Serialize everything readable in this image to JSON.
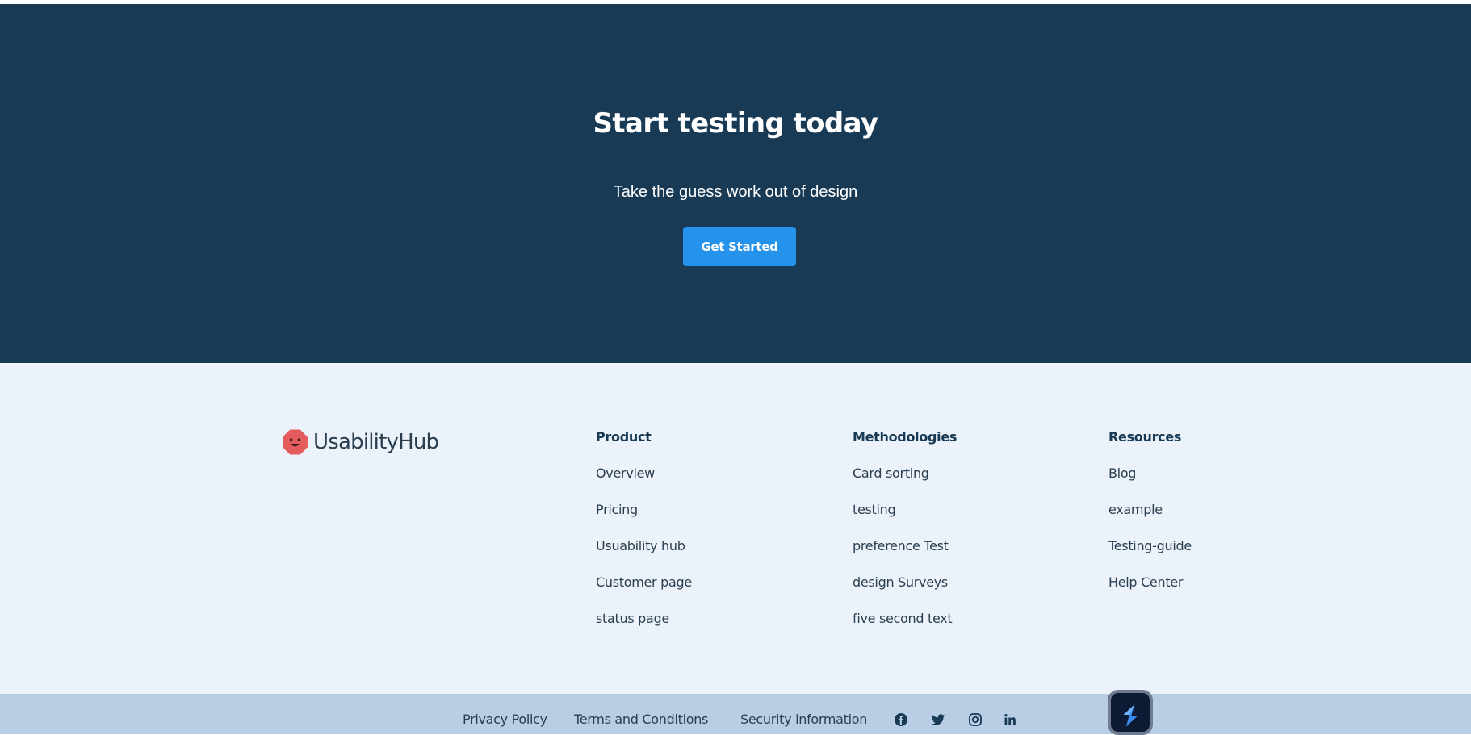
{
  "colors": {
    "cta_background": "#183a54",
    "cta_button": "#2592ec",
    "footer_background": "#ebf2fa",
    "bottom_bar_background": "#b9cde4",
    "link_text": "#2a3e50",
    "logo_red": "#e45c5c"
  },
  "cta": {
    "title": "Start testing today",
    "subtitle": "Take the guess work out of design",
    "button_label": "Get Started"
  },
  "footer": {
    "brand": {
      "name": "UsabilityHub",
      "logo_icon": "usabilityhub-logo-icon"
    },
    "columns": [
      {
        "heading": "Product",
        "links": [
          "Overview",
          "Pricing",
          "Usuability hub",
          "Customer page",
          "status page"
        ]
      },
      {
        "heading": "Methodologies",
        "links": [
          "Card sorting",
          "testing",
          "preference Test",
          "design Surveys",
          "five second text"
        ]
      },
      {
        "heading": "Resources",
        "links": [
          "Blog",
          "example",
          "Testing-guide",
          "Help Center"
        ]
      }
    ]
  },
  "bottom_bar": {
    "links": [
      "Privacy Policy",
      "Terms and Conditions",
      "Security information"
    ],
    "social_icons": [
      "facebook-icon",
      "twitter-icon",
      "instagram-icon",
      "linkedin-icon"
    ],
    "widget_icon": "stackblitz-bolt-icon"
  }
}
